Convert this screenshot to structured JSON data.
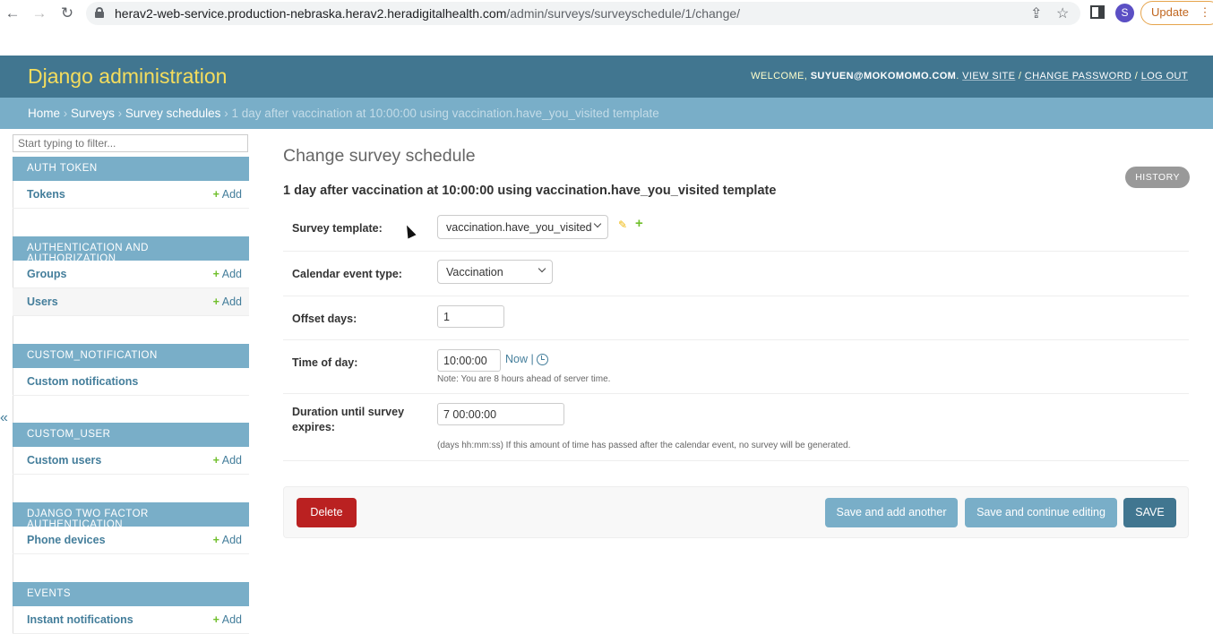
{
  "browser": {
    "url_domain": "herav2-web-service.production-nebraska.herav2.heradigitalhealth.com",
    "url_path": "/admin/surveys/surveyschedule/1/change/",
    "profile_initial": "S",
    "update_label": "Update",
    "icons": [
      "back-icon",
      "forward-icon",
      "reload-icon",
      "lock-icon",
      "share-icon",
      "star-icon",
      "sidepanel-icon",
      "menu-icon"
    ]
  },
  "header": {
    "brand": "Django administration",
    "welcome": "WELCOME,",
    "user": "SUYUEN@MOKOMOMO.COM",
    "view_site": "VIEW SITE",
    "change_password": "CHANGE PASSWORD",
    "log_out": "LOG OUT",
    "sep1": ".",
    "sep2": "/",
    "sep3": "/"
  },
  "breadcrumbs": {
    "home": "Home",
    "surveys": "Surveys",
    "survey_schedules": "Survey schedules",
    "current": "1 day after vaccination at 10:00:00 using vaccination.have_you_visited template",
    "sep": "›"
  },
  "sidebar": {
    "filter_placeholder": "Start typing to filter...",
    "add_label": "Add",
    "collapse": "«",
    "modules": [
      {
        "caption": "AUTH TOKEN",
        "rows": [
          {
            "label": "Tokens",
            "add": true
          }
        ]
      },
      {
        "caption": "AUTHENTICATION AND AUTHORIZATION",
        "rows": [
          {
            "label": "Groups",
            "add": true
          },
          {
            "label": "Users",
            "add": true
          }
        ]
      },
      {
        "caption": "CUSTOM_NOTIFICATION",
        "rows": [
          {
            "label": "Custom notifications",
            "add": false
          }
        ]
      },
      {
        "caption": "CUSTOM_USER",
        "rows": [
          {
            "label": "Custom users",
            "add": true
          }
        ]
      },
      {
        "caption": "DJANGO TWO FACTOR AUTHENTICATION",
        "rows": [
          {
            "label": "Phone devices",
            "add": true
          }
        ]
      },
      {
        "caption": "EVENTS",
        "rows": [
          {
            "label": "Instant notifications",
            "add": true
          }
        ]
      }
    ]
  },
  "main": {
    "title": "Change survey schedule",
    "object_name": "1 day after vaccination at 10:00:00 using vaccination.have_you_visited template",
    "history": "HISTORY",
    "fields": {
      "survey_template": {
        "label": "Survey template:",
        "value": "vaccination.have_you_visited"
      },
      "calendar_event_type": {
        "label": "Calendar event type:",
        "value": "Vaccination"
      },
      "offset_days": {
        "label": "Offset days:",
        "value": "1"
      },
      "time_of_day": {
        "label": "Time of day:",
        "value": "10:00:00",
        "now": "Now |",
        "note": "Note: You are 8 hours ahead of server time."
      },
      "duration": {
        "label_line1": "Duration until survey",
        "label_line2": "expires:",
        "value": "7 00:00:00",
        "help": "(days hh:mm:ss) If this amount of time has passed after the calendar event, no survey will be generated."
      }
    },
    "buttons": {
      "delete": "Delete",
      "save_add_another": "Save and add another",
      "save_continue": "Save and continue editing",
      "save": "SAVE"
    }
  }
}
